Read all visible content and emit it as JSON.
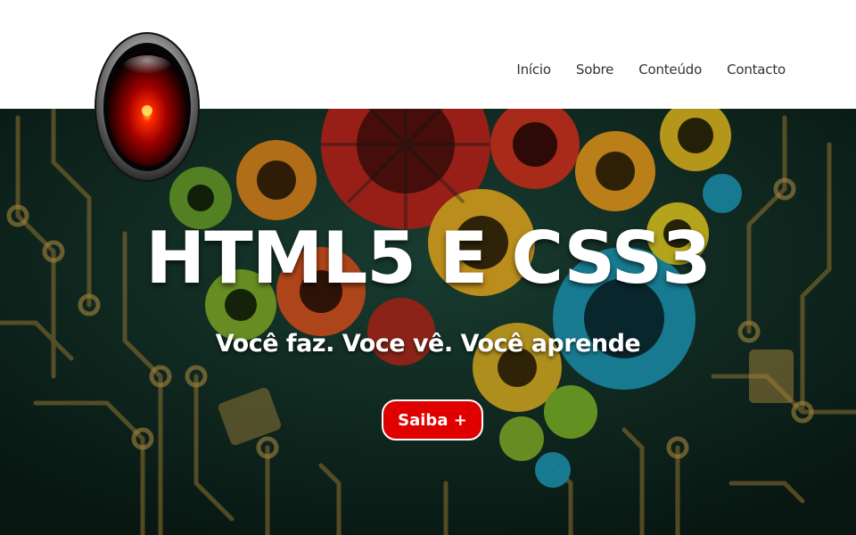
{
  "nav": {
    "items": [
      {
        "label": "Início"
      },
      {
        "label": "Sobre"
      },
      {
        "label": "Conteúdo"
      },
      {
        "label": "Contacto"
      }
    ]
  },
  "hero": {
    "title": "HTML5 E CSS3",
    "subtitle": "Você faz. Voce vê. Você aprende",
    "button_label": "Saiba +"
  },
  "colors": {
    "header_bg": "#ffffff",
    "nav_text": "#333333",
    "button_bg": "#e10000",
    "hero_bg": "#0f2a22",
    "logo_red": "#e00000"
  },
  "icons": {
    "logo": "hal-9000-eye-icon",
    "background": "circuit-gears-brain-illustration"
  }
}
